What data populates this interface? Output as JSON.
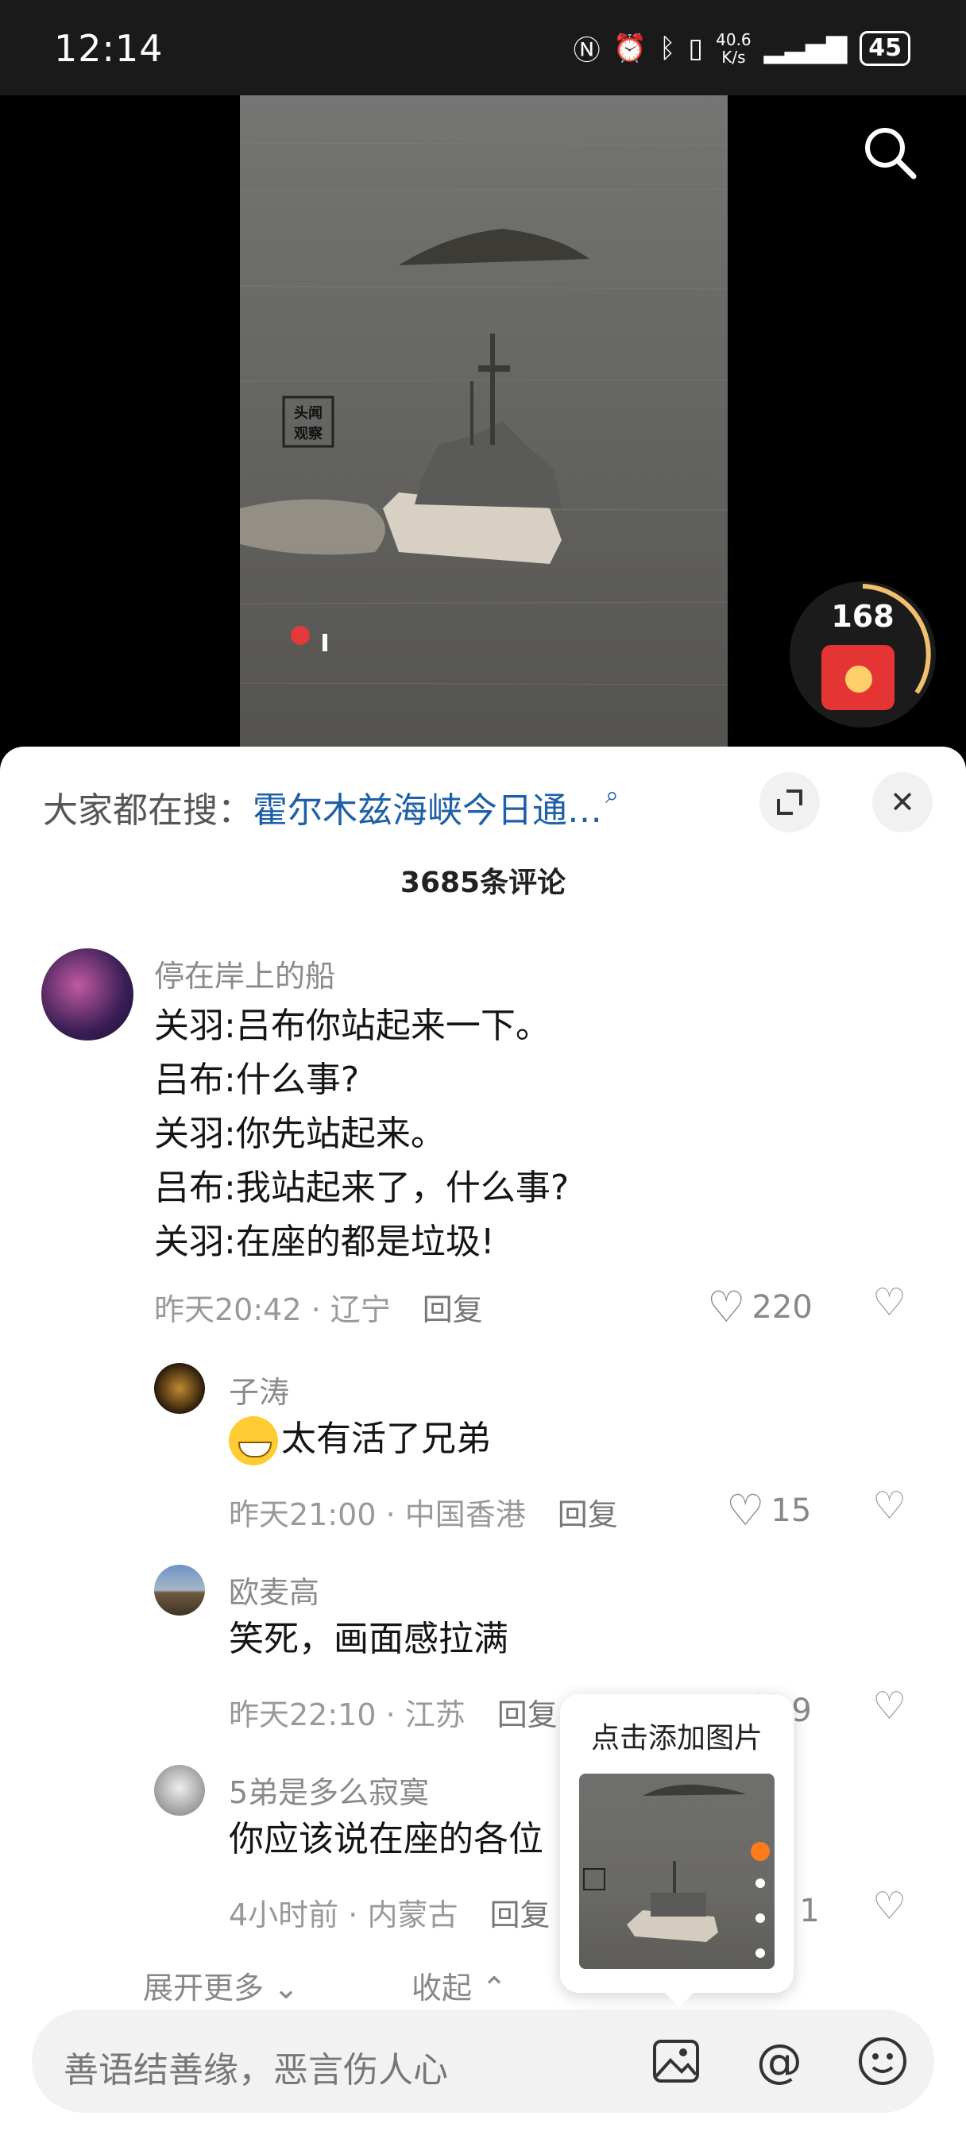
{
  "status_bar": {
    "time": "12:14",
    "network_speed_value": "40.6",
    "network_speed_unit": "K/s",
    "battery": "45"
  },
  "video": {
    "watermark": "头闻观察",
    "redpacket_count": "168"
  },
  "trending": {
    "prefix": "大家都在搜：",
    "query": "霍尔木兹海峡今日通…"
  },
  "comments_header": {
    "count_label": "3685条评论"
  },
  "comments": [
    {
      "author": "停在岸上的船",
      "lines": [
        "关羽:吕布你站起来一下。",
        "吕布:什么事?",
        "关羽:你先站起来。",
        "吕布:我站起来了，什么事?",
        "关羽:在座的都是垃圾!"
      ],
      "time": "昨天20:42",
      "location": "辽宁",
      "reply_label": "回复",
      "likes": "220"
    },
    {
      "author": "子涛",
      "text": "太有活了兄弟",
      "time": "昨天21:00",
      "location": "中国香港",
      "reply_label": "回复",
      "likes": "15"
    },
    {
      "author": "欧麦高",
      "text": "笑死，画面感拉满",
      "time": "昨天22:10",
      "location": "江苏",
      "reply_label": "回复",
      "likes": "9"
    },
    {
      "author": "5弟是多么寂寞",
      "text": "你应该说在座的各位",
      "time": "4小时前",
      "location": "内蒙古",
      "reply_label": "回复",
      "likes": "1"
    }
  ],
  "more": {
    "expand": "展开更多",
    "collapse": "收起"
  },
  "popup": {
    "title": "点击添加图片"
  },
  "input": {
    "placeholder": "善语结善缘，恶言伤人心"
  },
  "colors": {
    "link": "#1d5fa8",
    "red_packet": "#e53434"
  }
}
